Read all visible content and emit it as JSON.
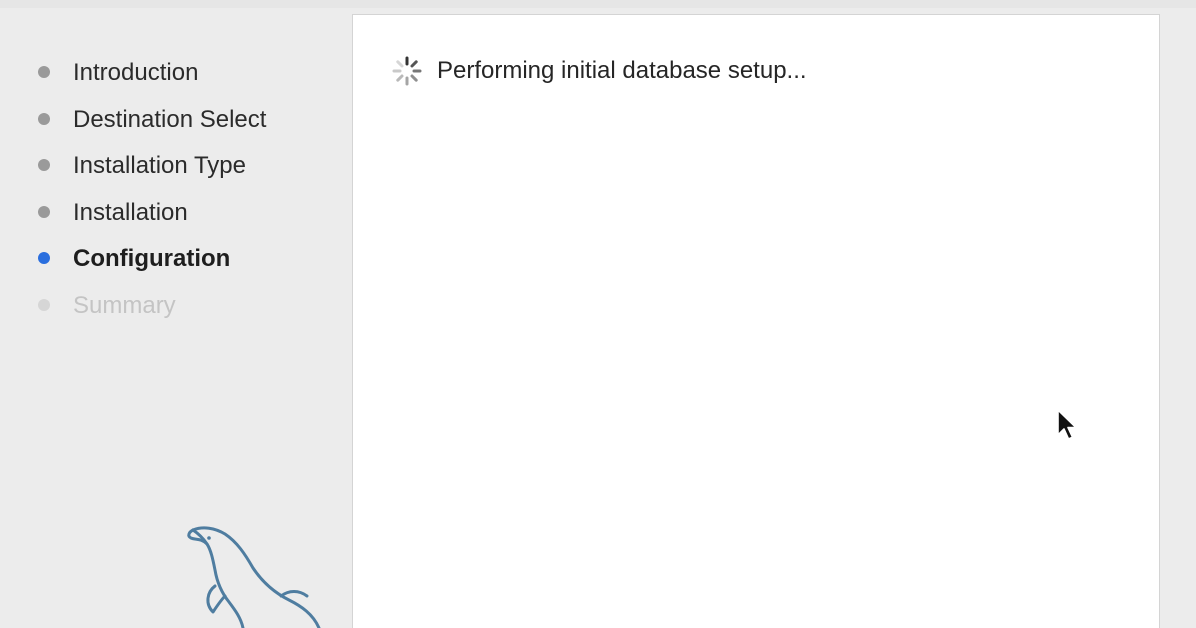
{
  "sidebar": {
    "steps": [
      {
        "label": "Introduction",
        "state": "completed"
      },
      {
        "label": "Destination Select",
        "state": "completed"
      },
      {
        "label": "Installation Type",
        "state": "completed"
      },
      {
        "label": "Installation",
        "state": "completed"
      },
      {
        "label": "Configuration",
        "state": "current"
      },
      {
        "label": "Summary",
        "state": "pending"
      }
    ],
    "logo": "mysql-dolphin-icon"
  },
  "content": {
    "status_text": "Performing initial database setup...",
    "spinner_icon": "loading-spinner-icon"
  },
  "colors": {
    "current_step_bullet": "#2a6ede",
    "completed_step_bullet": "#9a9a9a",
    "pending_step_text": "#c4c4c4",
    "logo_stroke": "#4f7da0"
  },
  "cursor": "pointer-cursor-icon"
}
